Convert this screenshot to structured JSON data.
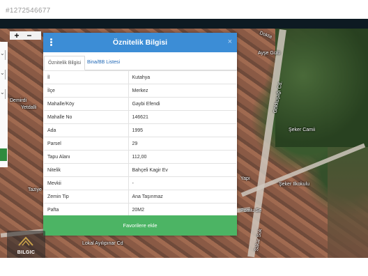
{
  "listing_id": "#1272546677",
  "map": {
    "labels": [
      "Dokta",
      "Ayşe Gülü",
      "Gökkuşağı Cd.",
      "Şeker Camii",
      "Şeker Ilkokulu",
      "Demirdi",
      "Yetdalli",
      "Taziye",
      "Yapı",
      "Pomlu Se",
      "Sakar Sok",
      "Lokal Ayılıpınar Cd"
    ]
  },
  "modal": {
    "title": "Öznitelik Bilgisi",
    "close": "×",
    "tabs": [
      "Öznitelik Bilgisi",
      "Bina/BB Listesi"
    ],
    "rows": [
      {
        "key": "İl",
        "value": "Kutahya"
      },
      {
        "key": "İlçe",
        "value": "Merkez"
      },
      {
        "key": "Mahalle/Köy",
        "value": "Gaybi Efendi"
      },
      {
        "key": "Mahalle No",
        "value": "146621"
      },
      {
        "key": "Ada",
        "value": "1995"
      },
      {
        "key": "Parsel",
        "value": "29"
      },
      {
        "key": "Tapu Alanı",
        "value": "112,00"
      },
      {
        "key": "Nitelik",
        "value": "Bahçeli Kagir Ev"
      },
      {
        "key": "Mevkii",
        "value": "-"
      },
      {
        "key": "Zemin Tip",
        "value": "Ana Taşınmaz"
      },
      {
        "key": "Pafta",
        "value": "20M2"
      }
    ],
    "favorite_button": "Favorilere ekle"
  },
  "logo": {
    "name": "BILGIC"
  },
  "colors": {
    "header": "#3c8dd6",
    "button": "#4cb464"
  }
}
